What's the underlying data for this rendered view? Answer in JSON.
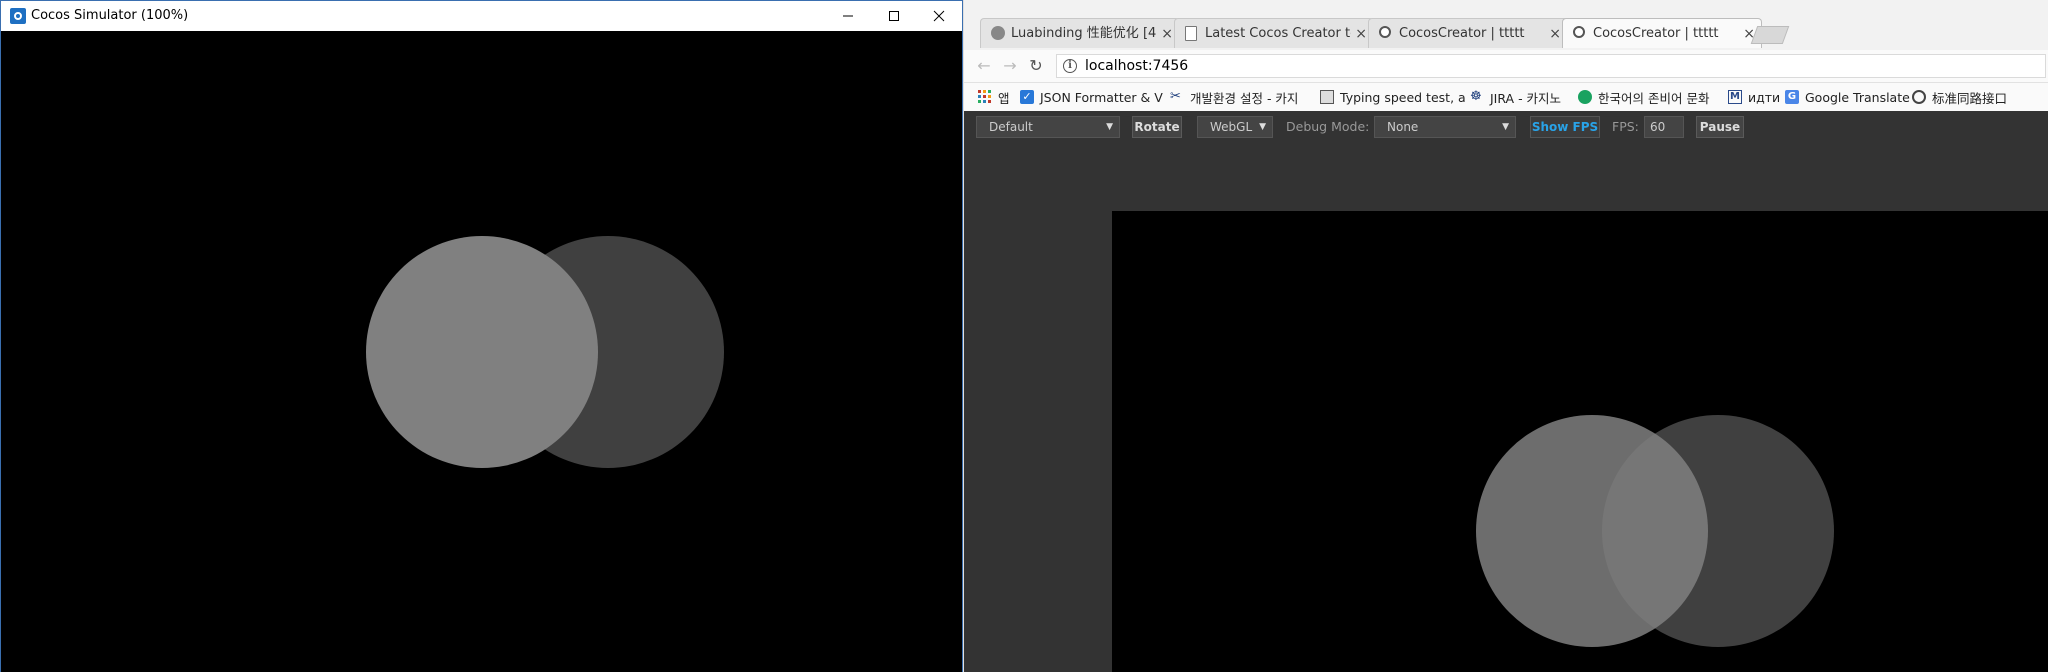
{
  "simulator": {
    "title": "Cocos Simulator (100%)",
    "minimize": "─",
    "maximize": "☐",
    "close": "✕",
    "circle_light_color": "#808080",
    "circle_dark_color": "#404040"
  },
  "browser": {
    "tabs": [
      {
        "title": "Luabinding 性能优化 [4",
        "close": "×"
      },
      {
        "title": "Latest Cocos Creator to",
        "close": "×"
      },
      {
        "title": "CocosCreator | ttttt",
        "close": "×"
      },
      {
        "title": "CocosCreator | ttttt",
        "close": "×"
      }
    ],
    "nav": {
      "back": "←",
      "forward": "→",
      "reload": "↻"
    },
    "url": "localhost:7456",
    "bookmarks": [
      {
        "label": "앱"
      },
      {
        "label": "JSON Formatter & V"
      },
      {
        "label": "개발환경 설정 - 카지"
      },
      {
        "label": "Typing speed test, a"
      },
      {
        "label": "JIRA - 카지노"
      },
      {
        "label": "한국어의 존비어 문화"
      },
      {
        "label": "идти"
      },
      {
        "label": "Google Translate"
      },
      {
        "label": "标准同路接口"
      }
    ],
    "controls": {
      "device_select": "Default",
      "rotate": "Rotate",
      "renderer_select": "WebGL",
      "debug_mode_label": "Debug Mode:",
      "debug_mode_select": "None",
      "show_fps": "Show FPS",
      "fps_label": "FPS:",
      "fps_value": "60",
      "pause": "Pause"
    },
    "show_fps_color": "#29a3e8"
  }
}
